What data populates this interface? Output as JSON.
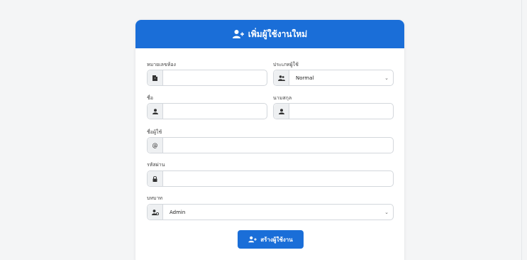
{
  "form": {
    "title": "เพิ่มผู้ใช้งานใหม่",
    "room_label": "หมายเลขห้อง",
    "room_value": "",
    "user_type_label": "ประเภทผู้ใช้",
    "user_type_value": "Normal",
    "first_name_label": "ชื่อ",
    "first_name_value": "",
    "last_name_label": "นามสกุล",
    "last_name_value": "",
    "username_label": "ชื่อผู้ใช้",
    "username_value": "",
    "password_label": "รหัสผ่าน",
    "password_value": "",
    "role_label": "บทบาท",
    "role_value": "Admin",
    "submit_label": "สร้างผู้ใช้งาน"
  },
  "icons": {
    "header": "user-plus-icon",
    "room": "door-icon",
    "user_type": "users-icon",
    "first_name": "user-icon",
    "last_name": "user-icon",
    "username": "at-icon",
    "password": "lock-icon",
    "role": "user-gear-icon",
    "submit": "user-plus-icon"
  },
  "colors": {
    "primary": "#1a6ed8",
    "background": "#f4f5f6",
    "addon": "#eef0f2",
    "border": "#d3d7dc"
  }
}
